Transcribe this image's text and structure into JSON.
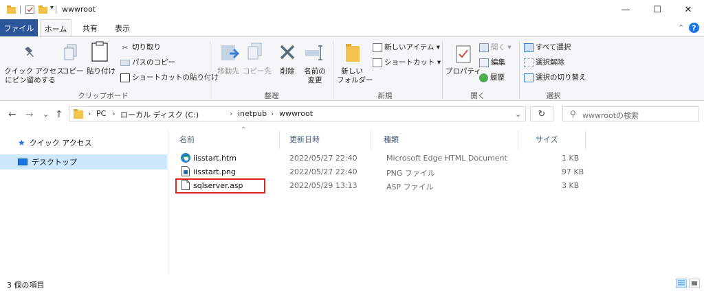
{
  "window": {
    "title": "wwwroot",
    "minimize_glyph": "—",
    "maximize_glyph": "☐",
    "close_glyph": "✕"
  },
  "ribbon_tabs": [
    {
      "label": "ファイル"
    },
    {
      "label": "ホーム"
    },
    {
      "label": "共有"
    },
    {
      "label": "表示"
    }
  ],
  "ribbon": {
    "clipboard": {
      "pin_line1": "クイック アクセス",
      "pin_line2": "にピン留めする",
      "copy": "コピー",
      "paste": "貼り付け",
      "cut": "切り取り",
      "copy_path": "パスのコピー",
      "paste_shortcut": "ショートカットの貼り付け",
      "group": "クリップボード"
    },
    "organize": {
      "move_to": "移動先",
      "copy_to": "コピー先",
      "delete": "削除",
      "rename_line1": "名前の",
      "rename_line2": "変更",
      "group": "整理"
    },
    "new": {
      "new_folder_line1": "新しい",
      "new_folder_line2": "フォルダー",
      "new_item": "新しいアイテム ▾",
      "easy_access": "ショートカット ▾",
      "group": "新規"
    },
    "open": {
      "properties": "プロパティ",
      "open": "開く ▾",
      "edit": "編集",
      "history": "履歴",
      "group": "開く"
    },
    "select": {
      "select_all": "すべて選択",
      "select_none": "選択解除",
      "invert": "選択の切り替え",
      "group": "選択"
    }
  },
  "address": {
    "crumbs": [
      "PC",
      "ローカル ディスク (C:)",
      "inetpub",
      "wwwroot"
    ],
    "search_placeholder": "wwwrootの検索",
    "back_glyph": "←",
    "forward_glyph": "→",
    "recent_glyph": "⌄",
    "up_glyph": "↑",
    "crumb_sep_glyph": "›",
    "dropdown_glyph": "⌄",
    "refresh_glyph": "↻",
    "search_glyph": "⚲"
  },
  "nav": [
    {
      "label": "クイック アクセス"
    },
    {
      "label": "デスクトップ"
    }
  ],
  "columns": {
    "name": "名前",
    "date": "更新日時",
    "type": "種類",
    "size": "サイズ",
    "sort_glyph": "⌃"
  },
  "files": [
    {
      "name": "iisstart.htm",
      "date": "2022/05/27 22:40",
      "type": "Microsoft Edge HTML Document",
      "size": "1 KB",
      "icon": "edge-html-icon"
    },
    {
      "name": "iisstart.png",
      "date": "2022/05/27 22:40",
      "type": "PNG ファイル",
      "size": "97 KB",
      "icon": "image-file-icon"
    },
    {
      "name": "sqlserver.asp",
      "date": "2022/05/29 13:13",
      "type": "ASP ファイル",
      "size": "3 KB",
      "icon": "blank-file-icon"
    }
  ],
  "status": {
    "item_count": "3 個の項目"
  },
  "colors": {
    "file_tab": "#2b579a",
    "selected_nav": "#cce8ff",
    "highlight": "#e52020",
    "folder": "#f3c24f"
  }
}
